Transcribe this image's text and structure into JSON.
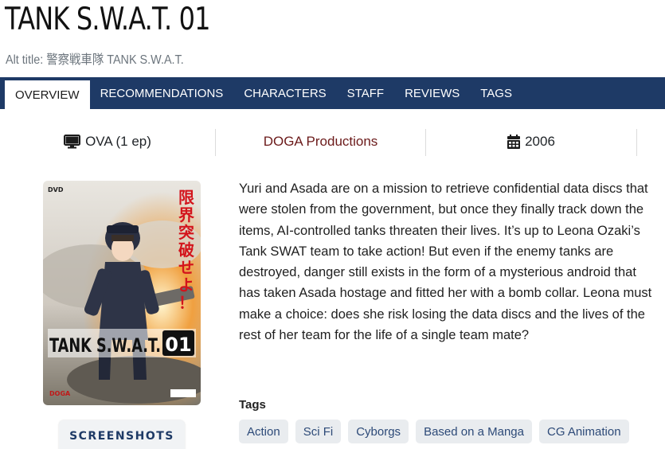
{
  "page": {
    "title": "TANK S.W.A.T. 01",
    "alt_title": "Alt title: 警察戦車隊 TANK S.W.A.T."
  },
  "tabs": [
    {
      "label": "OVERVIEW",
      "active": true
    },
    {
      "label": "RECOMMENDATIONS",
      "active": false
    },
    {
      "label": "CHARACTERS",
      "active": false
    },
    {
      "label": "STAFF",
      "active": false
    },
    {
      "label": "REVIEWS",
      "active": false
    },
    {
      "label": "TAGS",
      "active": false
    }
  ],
  "info": {
    "format": "OVA (1 ep)",
    "format_icon": "monitor-icon",
    "studio": "DOGA Productions",
    "year": "2006",
    "year_icon": "calendar-icon"
  },
  "cover": {
    "dvd_label": "DVD",
    "vertical_text": "限界突破せよ！",
    "logo_text": "TANK S.W.A.T.",
    "logo_number": "01",
    "publisher": "DOGA"
  },
  "screenshots_button": "SCREENSHOTS",
  "synopsis": "Yuri and Asada are on a mission to retrieve confidential data discs that were stolen from the government, but once they finally track down the items, AI-controlled tanks threaten their lives. It’s up to Leona Ozaki’s Tank SWAT team to take action! But even if the enemy tanks are destroyed, danger still exists in the form of a mysterious android that has taken Asada hostage and fitted her with a bomb collar. Leona must make a choice: does she risk losing the data discs and the lives of the rest of her team for the life of a single team mate?",
  "tags": {
    "label": "Tags",
    "items": [
      "Action",
      "Sci Fi",
      "Cyborgs",
      "Based on a Manga",
      "CG Animation"
    ]
  },
  "colors": {
    "nav_bg": "#1e3a66",
    "studio_link": "#6b1a1a",
    "tag_bg": "#e9ecef",
    "tag_text": "#2d4a78"
  }
}
